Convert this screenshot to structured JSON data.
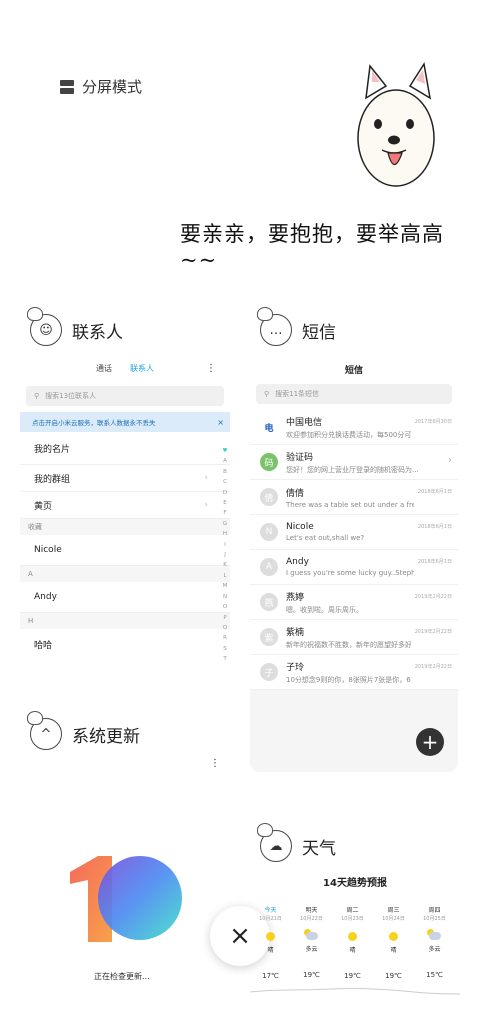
{
  "split_screen": {
    "label": "分屏模式"
  },
  "slogan": "要亲亲，要抱抱，要举高高~~",
  "contacts": {
    "title": "联系人",
    "tabs": [
      "通话",
      "联系人"
    ],
    "search_placeholder": "搜索13位联系人",
    "banner": "点击开启小米云服务，联系人数据永不丢失",
    "items": [
      "我的名片",
      "我的群组",
      "黄页"
    ],
    "section_fav": "收藏",
    "fav_name": "Nicole",
    "section_a": "A",
    "a_name": "Andy",
    "section_h": "H",
    "h_name": "哈哈",
    "alphabet": [
      "♥",
      "A",
      "B",
      "C",
      "D",
      "E",
      "F",
      "G",
      "H",
      "I",
      "J",
      "K",
      "L",
      "M",
      "N",
      "O",
      "P",
      "Q",
      "R",
      "S",
      "T"
    ]
  },
  "sms": {
    "title": "短信",
    "header": "短信",
    "search_placeholder": "搜索11条短信",
    "messages": [
      {
        "avatar": "电",
        "name": "中国电信",
        "preview": "欢迎参加积分兑换话费活动，每500分可...",
        "time": "2017年6月30日"
      },
      {
        "avatar": "码",
        "name": "验证码",
        "preview": "您好！您的网上营业厅登录的随机密码为...",
        "time": ""
      },
      {
        "avatar": "倩",
        "name": "倩倩",
        "preview": "There was a table set out under a free i...",
        "time": "2018年6月1日"
      },
      {
        "avatar": "N",
        "name": "Nicole",
        "preview": "Let's eat out,shall we?",
        "time": "2018年6月1日"
      },
      {
        "avatar": "A",
        "name": "Andy",
        "preview": "I guess you're some lucky guy..Stepha...",
        "time": "2018年6月1日"
      },
      {
        "avatar": "燕",
        "name": "燕婷",
        "preview": "嗯。收到啦。周乐周乐。",
        "time": "2019年2月22日"
      },
      {
        "avatar": "紫",
        "name": "紫楠",
        "preview": "新年的祝福数不胜数，新年的愿望好多好...",
        "time": "2019年2月22日"
      },
      {
        "avatar": "子",
        "name": "子玲",
        "preview": "10分想念9则的你，8张照片7张是你，6只...",
        "time": "2019年2月22日"
      }
    ],
    "fab": "+"
  },
  "update": {
    "title": "系统更新",
    "status": "正在检查更新...",
    "logo_text": "10"
  },
  "close_label": "×",
  "weather": {
    "title": "天气",
    "forecast_title": "14天趋势预报",
    "days": [
      {
        "day": "今天",
        "date": "10月21日",
        "cond": "晴",
        "temp": "17℃",
        "icon": "sun"
      },
      {
        "day": "明天",
        "date": "10月22日",
        "cond": "多云",
        "temp": "19℃",
        "icon": "cloud"
      },
      {
        "day": "周二",
        "date": "10月23日",
        "cond": "晴",
        "temp": "19℃",
        "icon": "sun"
      },
      {
        "day": "周三",
        "date": "10月24日",
        "cond": "晴",
        "temp": "19℃",
        "icon": "sun"
      },
      {
        "day": "周四",
        "date": "10月25日",
        "cond": "多云",
        "temp": "15℃",
        "icon": "cloud"
      }
    ]
  },
  "colors": {
    "accent": "#1aa3e0",
    "banner_bg": "#dcebf9",
    "green": "#7ac36a",
    "telecom": "#1a5bc4"
  }
}
